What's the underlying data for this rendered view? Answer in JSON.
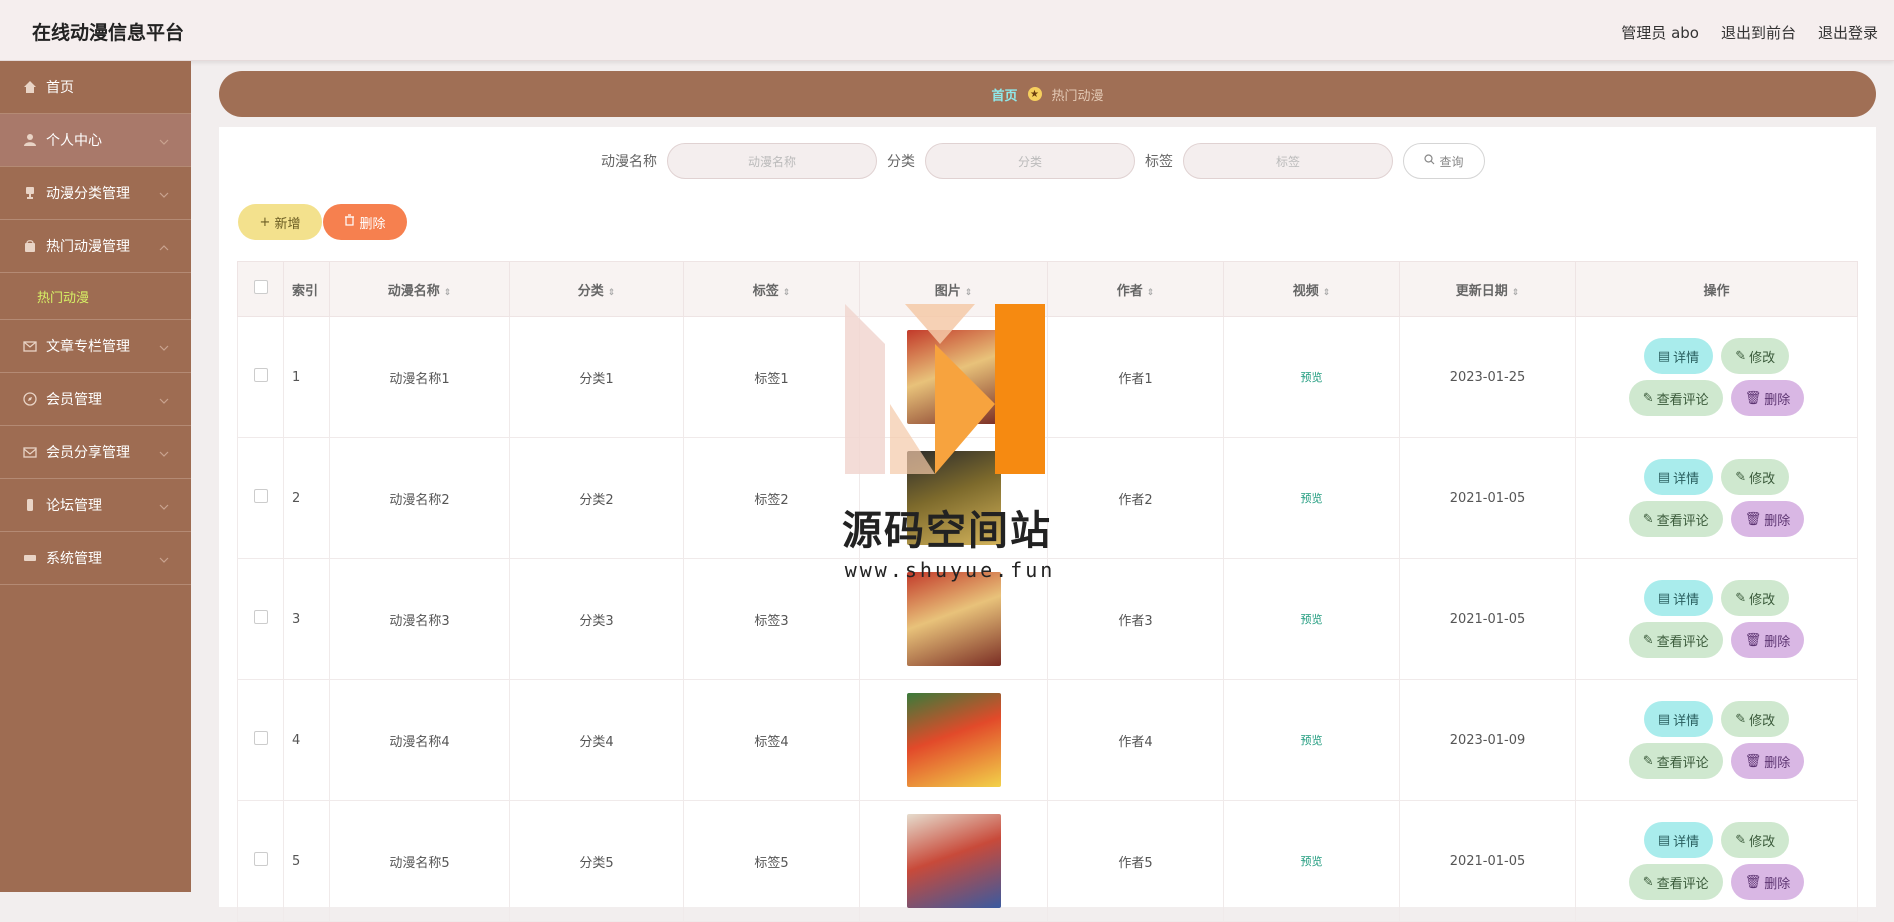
{
  "app": {
    "title": "在线动漫信息平台"
  },
  "header": {
    "links": [
      "管理员 abo",
      "退出到前台",
      "退出登录"
    ]
  },
  "sidebar": {
    "items": [
      {
        "label": "首页",
        "icon": "home-icon"
      },
      {
        "label": "个人中心",
        "icon": "user-icon"
      },
      {
        "label": "动漫分类管理",
        "icon": "trophy-icon"
      },
      {
        "label": "热门动漫管理",
        "icon": "bag-icon"
      },
      {
        "label": "文章专栏管理",
        "icon": "mail-icon"
      },
      {
        "label": "会员管理",
        "icon": "compass-icon"
      },
      {
        "label": "会员分享管理",
        "icon": "envelope-icon"
      },
      {
        "label": "论坛管理",
        "icon": "phone-icon"
      },
      {
        "label": "系统管理",
        "icon": "ticket-icon"
      }
    ],
    "submenu": "热门动漫"
  },
  "breadcrumb": {
    "home": "首页",
    "current": "热门动漫"
  },
  "search": {
    "name_label": "动漫名称",
    "name_placeholder": "动漫名称",
    "category_label": "分类",
    "category_placeholder": "分类",
    "tag_label": "标签",
    "tag_placeholder": "标签",
    "query_label": "查询"
  },
  "toolbar": {
    "add_label": "新增",
    "delete_label": "删除"
  },
  "table": {
    "headers": [
      "索引",
      "动漫名称",
      "分类",
      "标签",
      "图片",
      "作者",
      "视频",
      "更新日期",
      "操作"
    ],
    "preview_label": "预览",
    "ops": {
      "detail": "详情",
      "edit": "修改",
      "comment": "查看评论",
      "delete": "删除"
    },
    "rows": [
      {
        "index": "1",
        "name": "动漫名称1",
        "category": "分类1",
        "tag": "标签1",
        "author": "作者1",
        "date": "2023-01-25"
      },
      {
        "index": "2",
        "name": "动漫名称2",
        "category": "分类2",
        "tag": "标签2",
        "author": "作者2",
        "date": "2021-01-05"
      },
      {
        "index": "3",
        "name": "动漫名称3",
        "category": "分类3",
        "tag": "标签3",
        "author": "作者3",
        "date": "2021-01-05"
      },
      {
        "index": "4",
        "name": "动漫名称4",
        "category": "分类4",
        "tag": "标签4",
        "author": "作者4",
        "date": "2023-01-09"
      },
      {
        "index": "5",
        "name": "动漫名称5",
        "category": "分类5",
        "tag": "标签5",
        "author": "作者5",
        "date": "2021-01-05"
      }
    ]
  },
  "watermark": {
    "title": "源码空间站",
    "url": "www.shuyue.fun"
  },
  "colors": {
    "sidebar": "#9e6c52",
    "accent": "#a06f55",
    "submenu_active": "#d7f065"
  }
}
